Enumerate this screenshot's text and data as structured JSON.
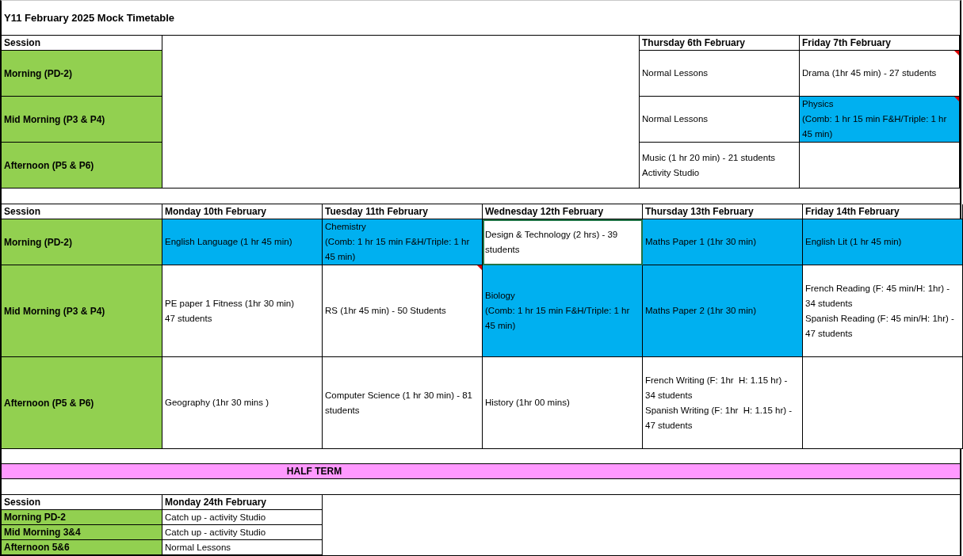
{
  "title": "Y11 February 2025 Mock Timetable",
  "blocks": [
    {
      "kind": "week_end",
      "header": "Session",
      "days": [
        "Thursday 6th February",
        "Friday 7th February"
      ],
      "rows": [
        {
          "session": "Morning (PD-2)",
          "cells": [
            {
              "lines": [
                "Normal Lessons"
              ],
              "highlight": false,
              "comment": false,
              "selected": false
            },
            {
              "lines": [
                "Drama (1hr 45 min) - 27 students"
              ],
              "highlight": false,
              "comment": true,
              "selected": false
            }
          ]
        },
        {
          "session": "Mid Morning (P3 & P4)",
          "cells": [
            {
              "lines": [
                "Normal Lessons"
              ],
              "highlight": false,
              "comment": false,
              "selected": false
            },
            {
              "lines": [
                "Physics",
                "(Comb: 1 hr 15 min F&H/Triple: 1 hr 45 min)"
              ],
              "highlight": true,
              "comment": true,
              "selected": false
            }
          ]
        },
        {
          "session": "Afternoon (P5 & P6)",
          "cells": [
            {
              "lines": [
                "Music (1 hr 20 min) - 21 students",
                "Activity Studio"
              ],
              "highlight": false,
              "comment": false,
              "selected": false
            },
            {
              "highlight": false,
              "comment": false,
              "selected": false
            }
          ]
        }
      ]
    },
    {
      "kind": "full_week",
      "header": "Session",
      "days": [
        "Monday 10th February",
        "Tuesday 11th February",
        "Wednesday 12th February",
        "Thursday 13th February",
        "Friday 14th February"
      ],
      "rows": [
        {
          "session": "Morning (PD-2)",
          "cells": [
            {
              "lines": [
                "English Language (1 hr 45 min)"
              ],
              "highlight": true,
              "comment": false,
              "selected": false
            },
            {
              "lines": [
                "Chemistry",
                "(Comb: 1 hr 15 min F&H/Triple: 1 hr 45 min)"
              ],
              "highlight": true,
              "comment": false,
              "selected": false
            },
            {
              "lines": [
                "Design & Technology (2 hrs) - 39 students"
              ],
              "highlight": false,
              "comment": false,
              "selected": true
            },
            {
              "lines": [
                "Maths Paper 1 (1hr 30 min)"
              ],
              "highlight": true,
              "comment": false,
              "selected": false
            },
            {
              "lines": [
                "English Lit (1 hr 45 min)"
              ],
              "highlight": true,
              "comment": false,
              "selected": false
            }
          ]
        },
        {
          "session": "Mid Morning (P3 & P4)",
          "cells": [
            {
              "lines": [
                "PE paper 1 Fitness (1hr 30 min)",
                "47 students"
              ],
              "highlight": false,
              "comment": false,
              "selected": false
            },
            {
              "lines": [
                "RS (1hr 45 min) - 50 Students"
              ],
              "highlight": false,
              "comment": true,
              "selected": false
            },
            {
              "lines": [
                "Biology",
                "(Comb: 1 hr 15 min F&H/Triple: 1 hr 45 min)"
              ],
              "highlight": true,
              "comment": false,
              "selected": false
            },
            {
              "lines": [
                "Maths Paper 2 (1hr 30 min)"
              ],
              "highlight": true,
              "comment": false,
              "selected": false
            },
            {
              "lines": [
                "French Reading (F: 45 min/H: 1hr) - 34 students",
                "Spanish Reading (F: 45 min/H: 1hr) - 47 students"
              ],
              "highlight": false,
              "comment": false,
              "selected": false
            }
          ]
        },
        {
          "session": "Afternoon (P5 & P6)",
          "cells": [
            {
              "lines": [
                "Geography (1hr 30 mins )"
              ],
              "highlight": false,
              "comment": false,
              "selected": false
            },
            {
              "lines": [
                "Computer Science (1 hr 30 min) - 81 students"
              ],
              "highlight": false,
              "comment": false,
              "selected": false
            },
            {
              "lines": [
                "History (1hr 00 mins)"
              ],
              "highlight": false,
              "comment": false,
              "selected": false
            },
            {
              "lines": [
                "French Writing (F: 1hr  H: 1.15 hr) - 34 students",
                "Spanish Writing (F: 1hr  H: 1.15 hr) - 47 students"
              ],
              "highlight": false,
              "comment": false,
              "selected": false
            },
            {
              "highlight": false,
              "comment": false,
              "selected": false
            }
          ]
        }
      ]
    },
    {
      "kind": "banner",
      "text": "HALF TERM"
    },
    {
      "kind": "week_start",
      "header": "Session",
      "days": [
        "Monday 24th February"
      ],
      "rows": [
        {
          "session": "Morning PD-2",
          "cells": [
            {
              "lines": [
                "Catch up - activity Studio"
              ],
              "highlight": false,
              "comment": false,
              "selected": false
            }
          ]
        },
        {
          "session": "Mid Morning 3&4",
          "cells": [
            {
              "lines": [
                "Catch up - activity Studio"
              ],
              "highlight": false,
              "comment": false,
              "selected": false
            }
          ]
        },
        {
          "session": "Afternoon 5&6",
          "cells": [
            {
              "lines": [
                "Normal Lessons"
              ],
              "highlight": false,
              "comment": false,
              "selected": false
            }
          ]
        }
      ]
    }
  ]
}
